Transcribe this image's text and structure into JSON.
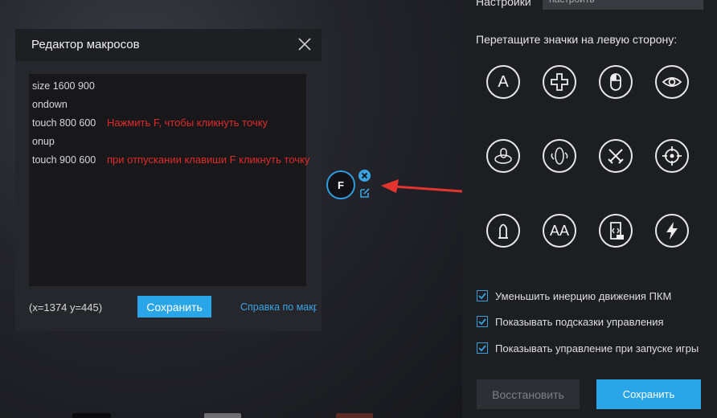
{
  "macro_editor": {
    "title": "Редактор макросов",
    "lines": [
      "size 1600 900",
      "ondown",
      "touch 800 600",
      "onup",
      "touch 900 600"
    ],
    "note_press": "Нажмить F, чтобы кликнуть точку",
    "note_release": "при отпускании клавиши F кликнуть точку",
    "coords": "(x=1374  y=445)",
    "save_label": "Сохранить",
    "help_link": "Справка по макросам"
  },
  "key_marker": {
    "key": "F"
  },
  "settings": {
    "label": "Настройки",
    "select_value": "настроить",
    "drag_hint": "Перетащите значки на левую сторону:",
    "icons": [
      {
        "name": "key-a-icon",
        "text": "A"
      },
      {
        "name": "dpad-icon"
      },
      {
        "name": "mouse-icon"
      },
      {
        "name": "eye-icon"
      },
      {
        "name": "mouse-rotate-icon"
      },
      {
        "name": "rotate-view-icon"
      },
      {
        "name": "crossed-swords-icon"
      },
      {
        "name": "crosshair-icon"
      },
      {
        "name": "bullet-icon"
      },
      {
        "name": "key-aa-icon",
        "text": "AA"
      },
      {
        "name": "script-icon"
      },
      {
        "name": "lightning-icon"
      }
    ],
    "options": [
      {
        "label": "Уменьшить инерцию движения ПКМ",
        "checked": true
      },
      {
        "label": "Показывать подсказки управления",
        "checked": true
      },
      {
        "label": "Показывать управление при запуске игры",
        "checked": true
      }
    ],
    "restore_label": "Восстановить",
    "save_label": "Сохранить"
  },
  "colors": {
    "accent": "#2aa6e8",
    "note_red": "#e12a2a",
    "panel_bg": "#1d1e22"
  }
}
